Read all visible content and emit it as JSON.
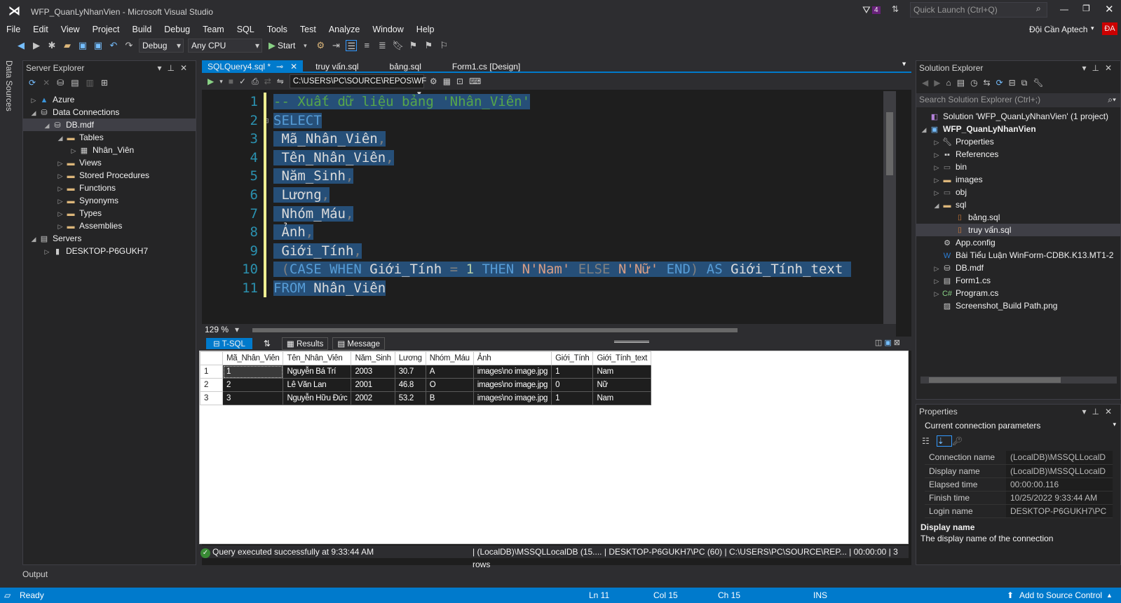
{
  "window": {
    "title": "WFP_QuanLyNhanVien - Microsoft Visual Studio",
    "notif_count": "4",
    "quick_launch": "Quick Launch (Ctrl+Q)",
    "user": "Đội Cần Aptech",
    "user_initials": "ĐA"
  },
  "menu": [
    "File",
    "Edit",
    "View",
    "Project",
    "Build",
    "Debug",
    "Team",
    "SQL",
    "Tools",
    "Test",
    "Analyze",
    "Window",
    "Help"
  ],
  "toolbar": {
    "config": "Debug",
    "platform": "Any CPU",
    "start": "Start"
  },
  "data_sources_tab": "Data Sources",
  "server_explorer": {
    "title": "Server Explorer",
    "items": [
      {
        "label": "Azure",
        "level": 0,
        "arrow": "▷",
        "icon": "azure"
      },
      {
        "label": "Data Connections",
        "level": 0,
        "arrow": "◢",
        "icon": "db"
      },
      {
        "label": "DB.mdf",
        "level": 1,
        "arrow": "◢",
        "icon": "db",
        "selected": true
      },
      {
        "label": "Tables",
        "level": 2,
        "arrow": "◢",
        "icon": "folder"
      },
      {
        "label": "Nhân_Viên",
        "level": 3,
        "arrow": "▷",
        "icon": "table"
      },
      {
        "label": "Views",
        "level": 2,
        "arrow": "▷",
        "icon": "folder"
      },
      {
        "label": "Stored Procedures",
        "level": 2,
        "arrow": "▷",
        "icon": "folder"
      },
      {
        "label": "Functions",
        "level": 2,
        "arrow": "▷",
        "icon": "folder"
      },
      {
        "label": "Synonyms",
        "level": 2,
        "arrow": "▷",
        "icon": "folder"
      },
      {
        "label": "Types",
        "level": 2,
        "arrow": "▷",
        "icon": "folder"
      },
      {
        "label": "Assemblies",
        "level": 2,
        "arrow": "▷",
        "icon": "folder"
      },
      {
        "label": "Servers",
        "level": 0,
        "arrow": "◢",
        "icon": "server"
      },
      {
        "label": "DESKTOP-P6GUKH7",
        "level": 1,
        "arrow": "▷",
        "icon": "pc"
      }
    ]
  },
  "tabs": [
    {
      "label": "SQLQuery4.sql *",
      "active": true
    },
    {
      "label": "truy vấn.sql"
    },
    {
      "label": "bảng.sql"
    },
    {
      "label": "Form1.cs [Design]"
    }
  ],
  "editor": {
    "path": "C:\\USERS\\PC\\SOURCE\\REPOS\\WF",
    "zoom": "129 %",
    "lines": [
      [
        {
          "t": "-- Xuất dữ liệu bảng 'Nhân_Viên'",
          "c": "cm"
        }
      ],
      [
        {
          "t": "SELECT",
          "c": "kw"
        }
      ],
      [
        {
          "t": " Mã_Nhân_Viên",
          "c": "id"
        },
        {
          "t": ",",
          "c": "gr"
        }
      ],
      [
        {
          "t": " Tên_Nhân_Viên",
          "c": "id"
        },
        {
          "t": ",",
          "c": "gr"
        }
      ],
      [
        {
          "t": " Năm_Sinh",
          "c": "id"
        },
        {
          "t": ",",
          "c": "gr"
        }
      ],
      [
        {
          "t": " Lương",
          "c": "id"
        },
        {
          "t": ",",
          "c": "gr"
        }
      ],
      [
        {
          "t": " Nhóm_Máu",
          "c": "id"
        },
        {
          "t": ",",
          "c": "gr"
        }
      ],
      [
        {
          "t": " Ảnh",
          "c": "id"
        },
        {
          "t": ",",
          "c": "gr"
        }
      ],
      [
        {
          "t": " Giới_Tính",
          "c": "id"
        },
        {
          "t": ",",
          "c": "gr"
        }
      ],
      [
        {
          "t": " (",
          "c": "gr"
        },
        {
          "t": "CASE WHEN ",
          "c": "kw"
        },
        {
          "t": "Giới_Tính ",
          "c": "id"
        },
        {
          "t": "= ",
          "c": "gr"
        },
        {
          "t": "1 ",
          "c": "nm"
        },
        {
          "t": "THEN ",
          "c": "kw"
        },
        {
          "t": "N'Nam' ",
          "c": "st"
        },
        {
          "t": "ELSE ",
          "c": "gr"
        },
        {
          "t": "N'Nữ' ",
          "c": "st"
        },
        {
          "t": "END",
          "c": "kw"
        },
        {
          "t": ") ",
          "c": "gr"
        },
        {
          "t": "AS ",
          "c": "kw"
        },
        {
          "t": "Giới_Tính_text ",
          "c": "id"
        }
      ],
      [
        {
          "t": "FROM ",
          "c": "kw"
        },
        {
          "t": "Nhân_Viên",
          "c": "id"
        }
      ]
    ]
  },
  "results": {
    "tsql_tab": "T-SQL",
    "results_tab": "Results",
    "message_tab": "Message",
    "columns": [
      "Mã_Nhân_Viên",
      "Tên_Nhân_Viên",
      "Năm_Sinh",
      "Lương",
      "Nhóm_Máu",
      "Ảnh",
      "Giới_Tính",
      "Giới_Tính_text"
    ],
    "rows": [
      [
        "1",
        "1",
        "Nguyễn Bá Trí",
        "2003",
        "30.7",
        "A",
        "images\\no image.jpg",
        "1",
        "Nam"
      ],
      [
        "2",
        "2",
        "Lê Văn Lan",
        "2001",
        "46.8",
        "O",
        "images\\no image.jpg",
        "0",
        "Nữ"
      ],
      [
        "3",
        "3",
        "Nguyễn Hữu Đức",
        "2002",
        "53.2",
        "B",
        "images\\no image.jpg",
        "1",
        "Nam"
      ]
    ]
  },
  "query_status": {
    "message": "Query executed successfully at 9:33:44 AM",
    "server": "(LocalDB)\\MSSQLLocalDB (15....",
    "user": "DESKTOP-P6GUKH7\\PC (60)",
    "path": "C:\\USERS\\PC\\SOURCE\\REP...",
    "time": "00:00:00",
    "rows": "3 rows"
  },
  "solution_explorer": {
    "title": "Solution Explorer",
    "search": "Search Solution Explorer (Ctrl+;)",
    "items": [
      {
        "label": "Solution 'WFP_QuanLyNhanVien' (1 project)",
        "level": 0,
        "arrow": "",
        "icon": "sln"
      },
      {
        "label": "WFP_QuanLyNhanVien",
        "level": 0,
        "arrow": "◢",
        "icon": "proj",
        "bold": true
      },
      {
        "label": "Properties",
        "level": 1,
        "arrow": "▷",
        "icon": "wrench"
      },
      {
        "label": "References",
        "level": 1,
        "arrow": "▷",
        "icon": "ref"
      },
      {
        "label": "bin",
        "level": 1,
        "arrow": "▷",
        "icon": "dfolder"
      },
      {
        "label": "images",
        "level": 1,
        "arrow": "▷",
        "icon": "folder"
      },
      {
        "label": "obj",
        "level": 1,
        "arrow": "▷",
        "icon": "dfolder"
      },
      {
        "label": "sql",
        "level": 1,
        "arrow": "◢",
        "icon": "ofolder"
      },
      {
        "label": "bảng.sql",
        "level": 2,
        "arrow": "",
        "icon": "sql"
      },
      {
        "label": "truy vấn.sql",
        "level": 2,
        "arrow": "",
        "icon": "sql",
        "selected": true
      },
      {
        "label": "App.config",
        "level": 1,
        "arrow": "",
        "icon": "cfg"
      },
      {
        "label": "Bài Tiểu Luận WinForm-CDBK.K13.MT1-2",
        "level": 1,
        "arrow": "",
        "icon": "word"
      },
      {
        "label": "DB.mdf",
        "level": 1,
        "arrow": "▷",
        "icon": "db"
      },
      {
        "label": "Form1.cs",
        "level": 1,
        "arrow": "▷",
        "icon": "form"
      },
      {
        "label": "Program.cs",
        "level": 1,
        "arrow": "▷",
        "icon": "cs"
      },
      {
        "label": "Screenshot_Build Path.png",
        "level": 1,
        "arrow": "",
        "icon": "img"
      }
    ]
  },
  "properties": {
    "title": "Properties",
    "object": "Current connection parameters",
    "rows": [
      [
        "Connection name",
        "(LocalDB)\\MSSQLLocalD"
      ],
      [
        "Display name",
        "(LocalDB)\\MSSQLLocalD"
      ],
      [
        "Elapsed time",
        "00:00:00.116"
      ],
      [
        "Finish time",
        "10/25/2022 9:33:44 AM"
      ],
      [
        "Login name",
        "DESKTOP-P6GUKH7\\PC"
      ]
    ],
    "desc_title": "Display name",
    "desc_text": "The display name of the connection"
  },
  "output_tab": "Output",
  "statusbar": {
    "ready": "Ready",
    "ln": "Ln 11",
    "col": "Col 15",
    "ch": "Ch 15",
    "ins": "INS",
    "source_control": "Add to Source Control"
  },
  "colors": {
    "accent": "#007acc",
    "selection": "#264f78"
  }
}
